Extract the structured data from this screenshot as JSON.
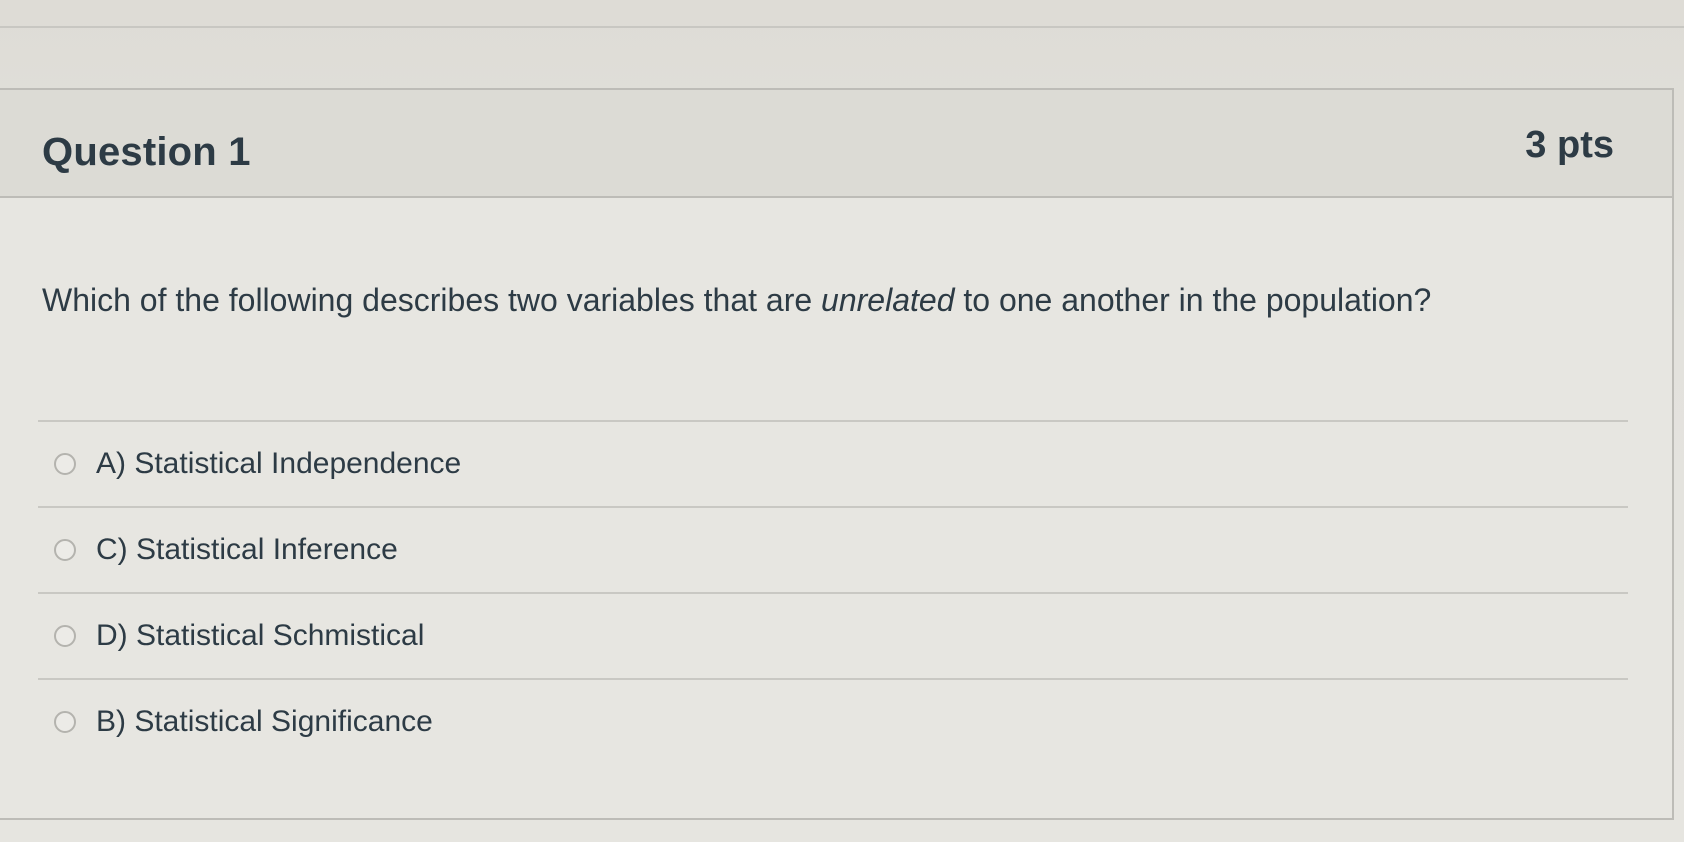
{
  "question": {
    "title": "Question 1",
    "points": "3 pts",
    "text_before": "Which of the following describes two variables that are ",
    "text_emphasis": "unrelated",
    "text_after": " to one another in the population?"
  },
  "answers": [
    {
      "label": "A) Statistical Independence"
    },
    {
      "label": "C) Statistical Inference"
    },
    {
      "label": "D) Statistical Schmistical"
    },
    {
      "label": "B) Statistical Significance"
    }
  ]
}
